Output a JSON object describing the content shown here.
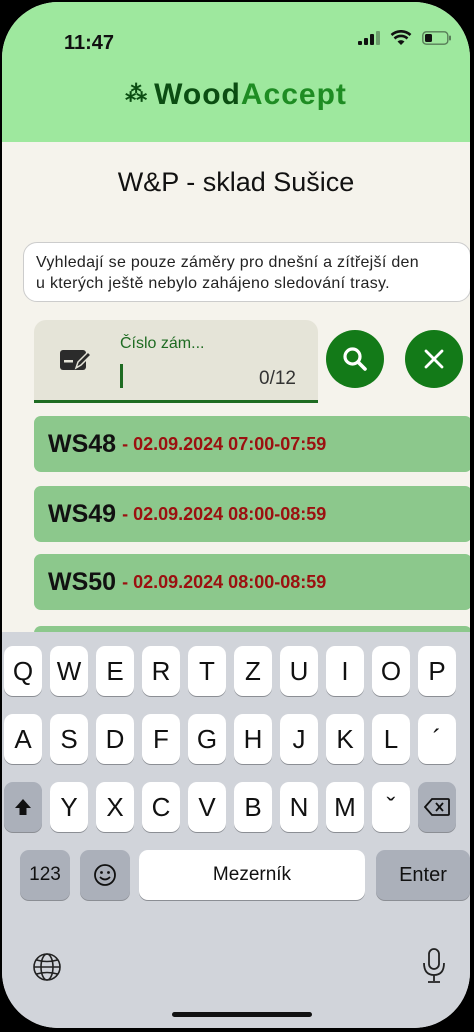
{
  "status": {
    "time": "11:47"
  },
  "app": {
    "logo_text_a": "Wood",
    "logo_text_b": "Accept",
    "logo_mark": "⁂"
  },
  "page": {
    "title": "W&P - sklad Sušice",
    "info_line1": "Vyhledají se pouze záměry pro dnešní a zítřejší den",
    "info_line2": "u kterých ještě nebylo zahájeno sledování trasy."
  },
  "search": {
    "label": "Číslo zám...",
    "value": "",
    "counter": "0/12"
  },
  "items": [
    {
      "code": "WS48",
      "sep": "-",
      "time": "02.09.2024 07:00-07:59"
    },
    {
      "code": "WS49",
      "sep": "-",
      "time": "02.09.2024 08:00-08:59"
    },
    {
      "code": "WS50",
      "sep": "-",
      "time": "02.09.2024 08:00-08:59"
    }
  ],
  "keyboard": {
    "row1": [
      "Q",
      "W",
      "E",
      "R",
      "T",
      "Z",
      "U",
      "I",
      "O",
      "P"
    ],
    "row2": [
      "A",
      "S",
      "D",
      "F",
      "G",
      "H",
      "J",
      "K",
      "L",
      "´"
    ],
    "row3": [
      "Y",
      "X",
      "C",
      "V",
      "B",
      "N",
      "M",
      "ˇ"
    ],
    "numbers_label": "123",
    "space_label": "Mezerník",
    "enter_label": "Enter"
  },
  "colors": {
    "header": "#9ee89e",
    "accent": "#137a18",
    "item_bg": "#8cc88c",
    "time_text": "#9b1010"
  }
}
